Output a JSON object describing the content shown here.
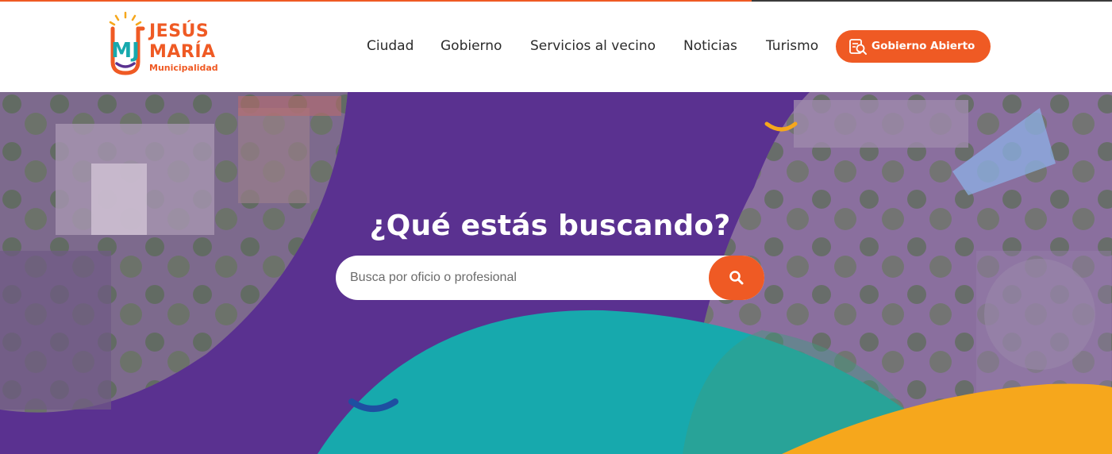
{
  "brand": {
    "name_line1": "JESÚS",
    "name_line2": "MARÍA",
    "name_line3": "Municipalidad",
    "monogram": "MJ",
    "colors": {
      "orange": "#ef5a24",
      "purple": "#5a3190",
      "teal": "#17a9ad",
      "yellow": "#f6a71c"
    }
  },
  "nav": {
    "items": [
      {
        "label": "Ciudad"
      },
      {
        "label": "Gobierno"
      },
      {
        "label": "Servicios al vecino"
      },
      {
        "label": "Noticias"
      },
      {
        "label": "Turismo"
      }
    ],
    "cta": {
      "label": "Gobierno Abierto",
      "icon": "document-search-icon"
    }
  },
  "hero": {
    "title": "¿Qué estás buscando?",
    "search": {
      "placeholder": "Busca por oficio o profesional",
      "value": "",
      "button_icon": "search-icon"
    }
  }
}
